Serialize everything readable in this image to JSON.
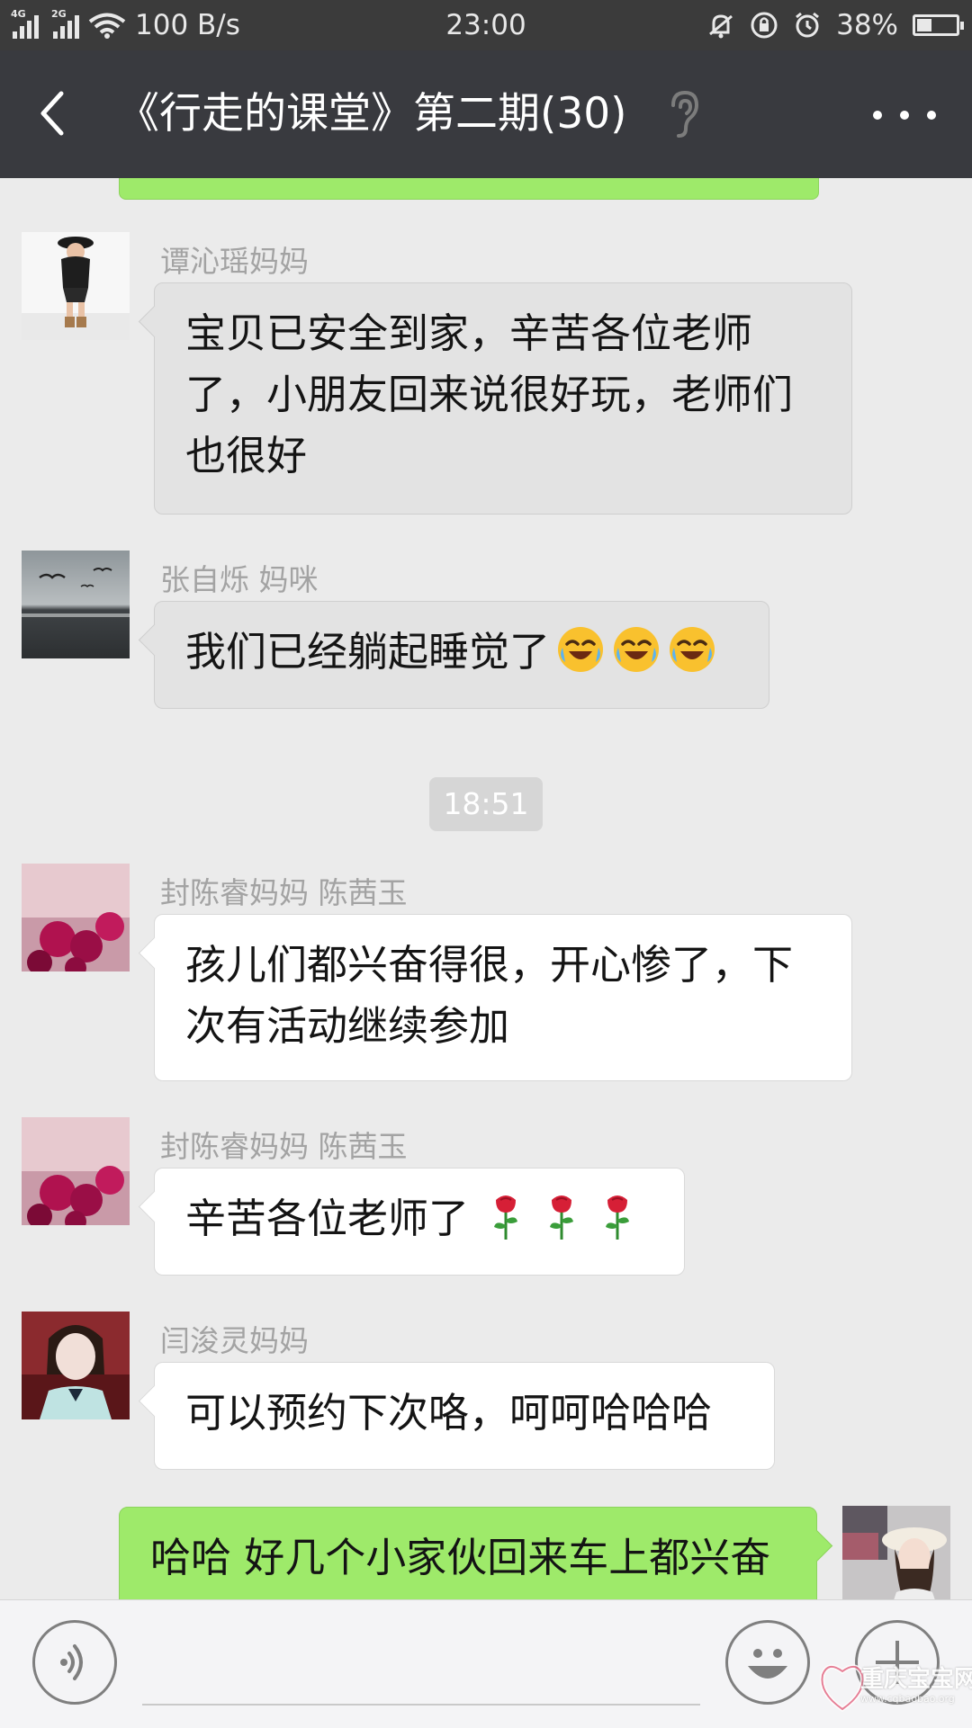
{
  "status_bar": {
    "network_1": "4G",
    "network_2": "2G",
    "speed": "100 B/s",
    "time": "23:00",
    "battery": "38%",
    "battery_level": 0.38
  },
  "header": {
    "title": "《行走的课堂》第二期(30)"
  },
  "messages": [
    {
      "sender": "谭沁瑶妈妈",
      "lines": [
        "宝贝已安全到家，辛苦各位老师",
        "了，小朋友回来说很好玩，老师们",
        "也很好"
      ]
    },
    {
      "sender": "张自烁 妈咪",
      "text": "我们已经躺起睡觉了"
    },
    {
      "sender": "封陈睿妈妈 陈茜玉",
      "lines": [
        "孩儿们都兴奋得很，开心惨了，下",
        "次有活动继续参加"
      ]
    },
    {
      "sender": "封陈睿妈妈 陈茜玉",
      "text": "辛苦各位老师了"
    },
    {
      "sender": "闫浚灵妈妈",
      "text": "可以预约下次咯，呵呵哈哈哈"
    },
    {
      "text": "哈哈 好几个小家伙回来车上都兴奋"
    }
  ],
  "timestamp": "18:51",
  "watermark": {
    "line1": "重庆宝宝网",
    "line2": "www.cqbaobao.org"
  },
  "colors": {
    "status_bar": "#3b3b3b",
    "title_bar": "#393a3f",
    "chat_bg": "#ebebeb",
    "bubble_green": "#9eea6a",
    "bubble_white": "#ffffff",
    "bubble_grey": "#e3e3e3",
    "sender_name": "#a3a3a3"
  }
}
